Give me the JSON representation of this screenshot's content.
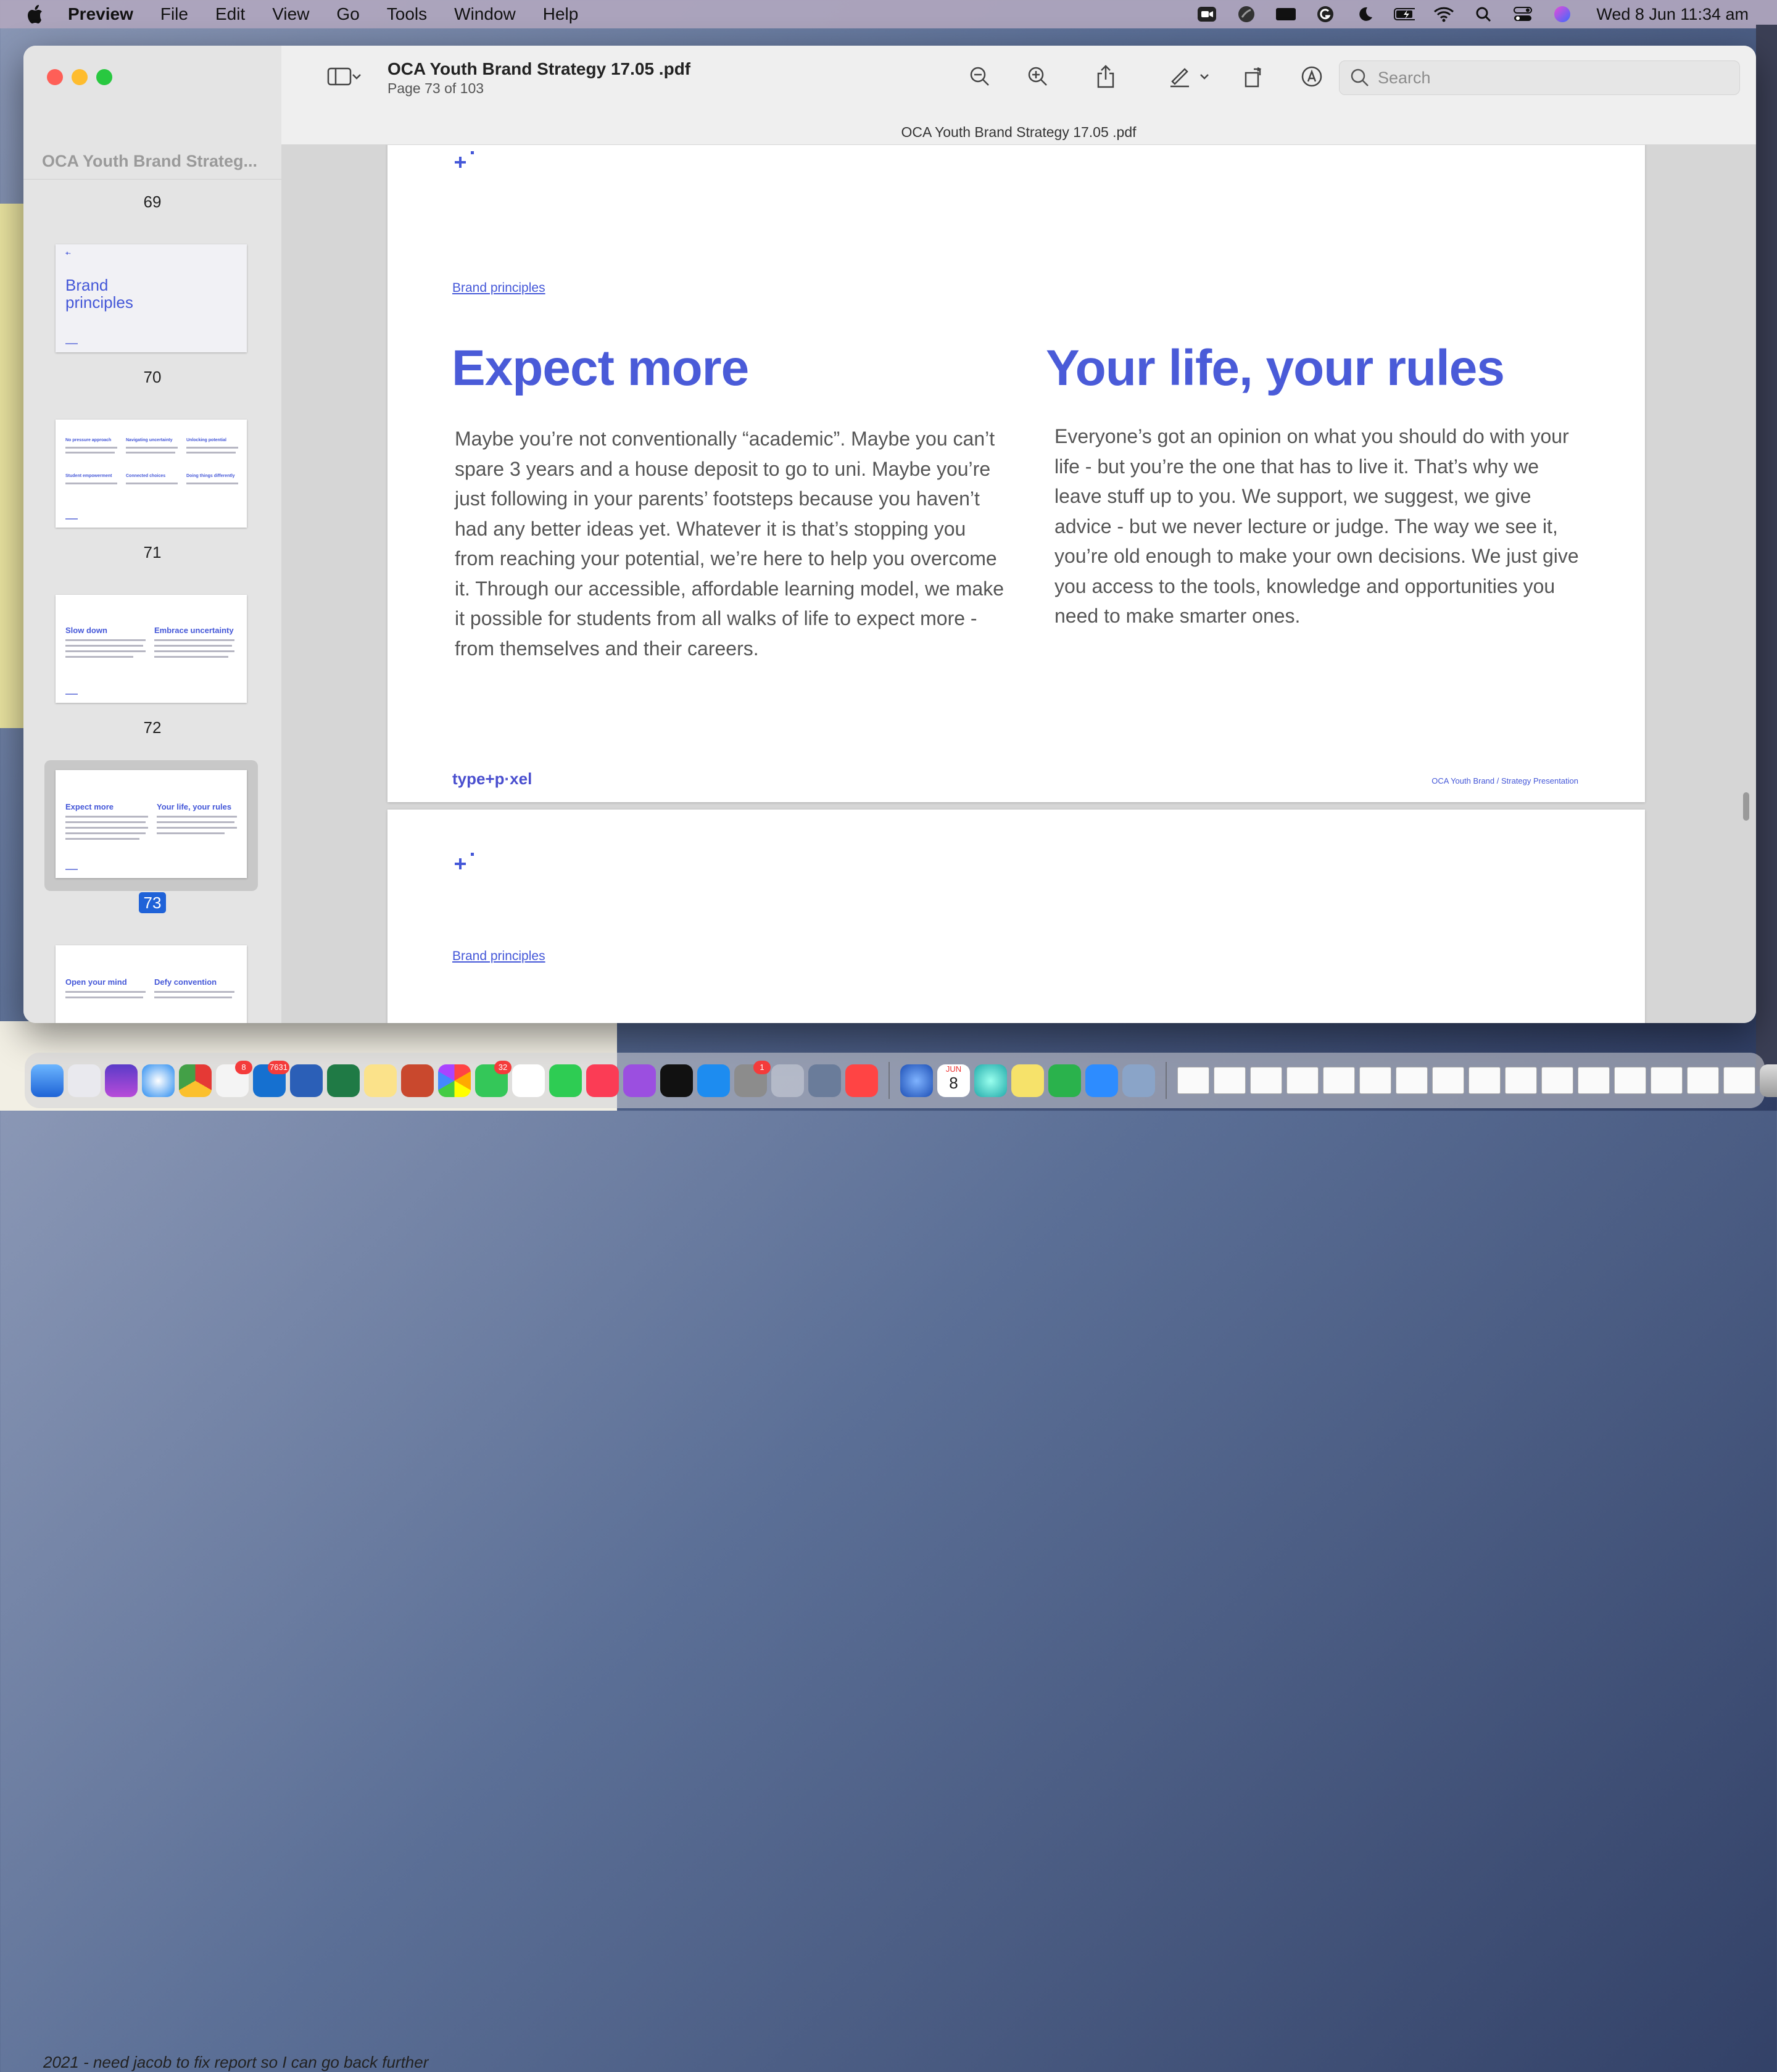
{
  "menubar": {
    "app": "Preview",
    "items": [
      "File",
      "Edit",
      "View",
      "Go",
      "Tools",
      "Window",
      "Help"
    ],
    "clock": "Wed 8 Jun  11:34 am",
    "status_icons": [
      "zoom-icon",
      "screen-record-icon",
      "camera-icon",
      "grammarly-icon",
      "moon-icon",
      "battery-icon",
      "wifi-icon",
      "spotlight-icon",
      "control-center-icon",
      "siri-icon"
    ]
  },
  "background": {
    "note_text": "2021 - need jacob to fix report so I can go back further"
  },
  "window": {
    "title": "OCA Youth Brand Strategy 17.05 .pdf",
    "subtitle": "Page 73 of 103",
    "tab_title": "OCA Youth Brand Strategy 17.05 .pdf",
    "search_placeholder": "Search",
    "toolbar_icons": [
      "sidebar-icon",
      "chevron-down-icon",
      "zoom-out-icon",
      "zoom-in-icon",
      "share-icon",
      "markup-pen-icon",
      "chevron-down-icon",
      "rotate-icon",
      "annotate-icon"
    ]
  },
  "sidebar": {
    "title": "OCA Youth Brand Strateg...",
    "pages": [
      {
        "num": "69"
      },
      {
        "num": "70",
        "title_a": "Brand",
        "title_b": "principles"
      },
      {
        "num": "71",
        "headings": [
          "No pressure approach",
          "Navigating uncertainty",
          "Unlocking potential",
          "Student empowerment",
          "Connected choices",
          "Doing things differently"
        ]
      },
      {
        "num": "72",
        "headings": [
          "Slow down",
          "Embrace uncertainty"
        ]
      },
      {
        "num": "73",
        "headings": [
          "Expect more",
          "Your life, your rules"
        ],
        "selected": true
      },
      {
        "headings": [
          "Open your mind",
          "Defy convention"
        ]
      }
    ]
  },
  "document": {
    "section_label": "Brand principles",
    "left_heading": "Expect more",
    "left_body": "Maybe you’re not conventionally “academic”. Maybe you can’t spare 3 years and a house deposit to go to uni. Maybe you’re just following in your parents’ footsteps because you haven’t had any better ideas yet. Whatever it is that’s stopping you from reaching your potential, we’re here to help you overcome it.  Through our accessible, affordable learning model, we make it possible for students from all walks of life to expect more - from themselves and their careers.",
    "right_heading": "Your life, your rules",
    "right_body": "Everyone’s got an opinion on what you should do with your life - but you’re the one that has to live it. That’s why we leave stuff up to you. We support, we suggest, we give advice - but we never lecture or judge. The way we see it, you’re old enough to make your own decisions. We just give you access to the tools, knowledge and opportunities you need to make smarter ones.",
    "footer_logo": "type+p·xel",
    "footer_right": "OCA Youth Brand / Strategy Presentation",
    "next_page_section_label": "Brand principles"
  },
  "dock": {
    "badges": {
      "reminders": "8",
      "outlook": "7631",
      "messages": "32",
      "settings": "1"
    },
    "calendar_month": "JUN",
    "calendar_day": "8"
  },
  "colors": {
    "accent_blue": "#4a5bd8",
    "selection_blue": "#1f62d8",
    "body_text": "#555555"
  }
}
